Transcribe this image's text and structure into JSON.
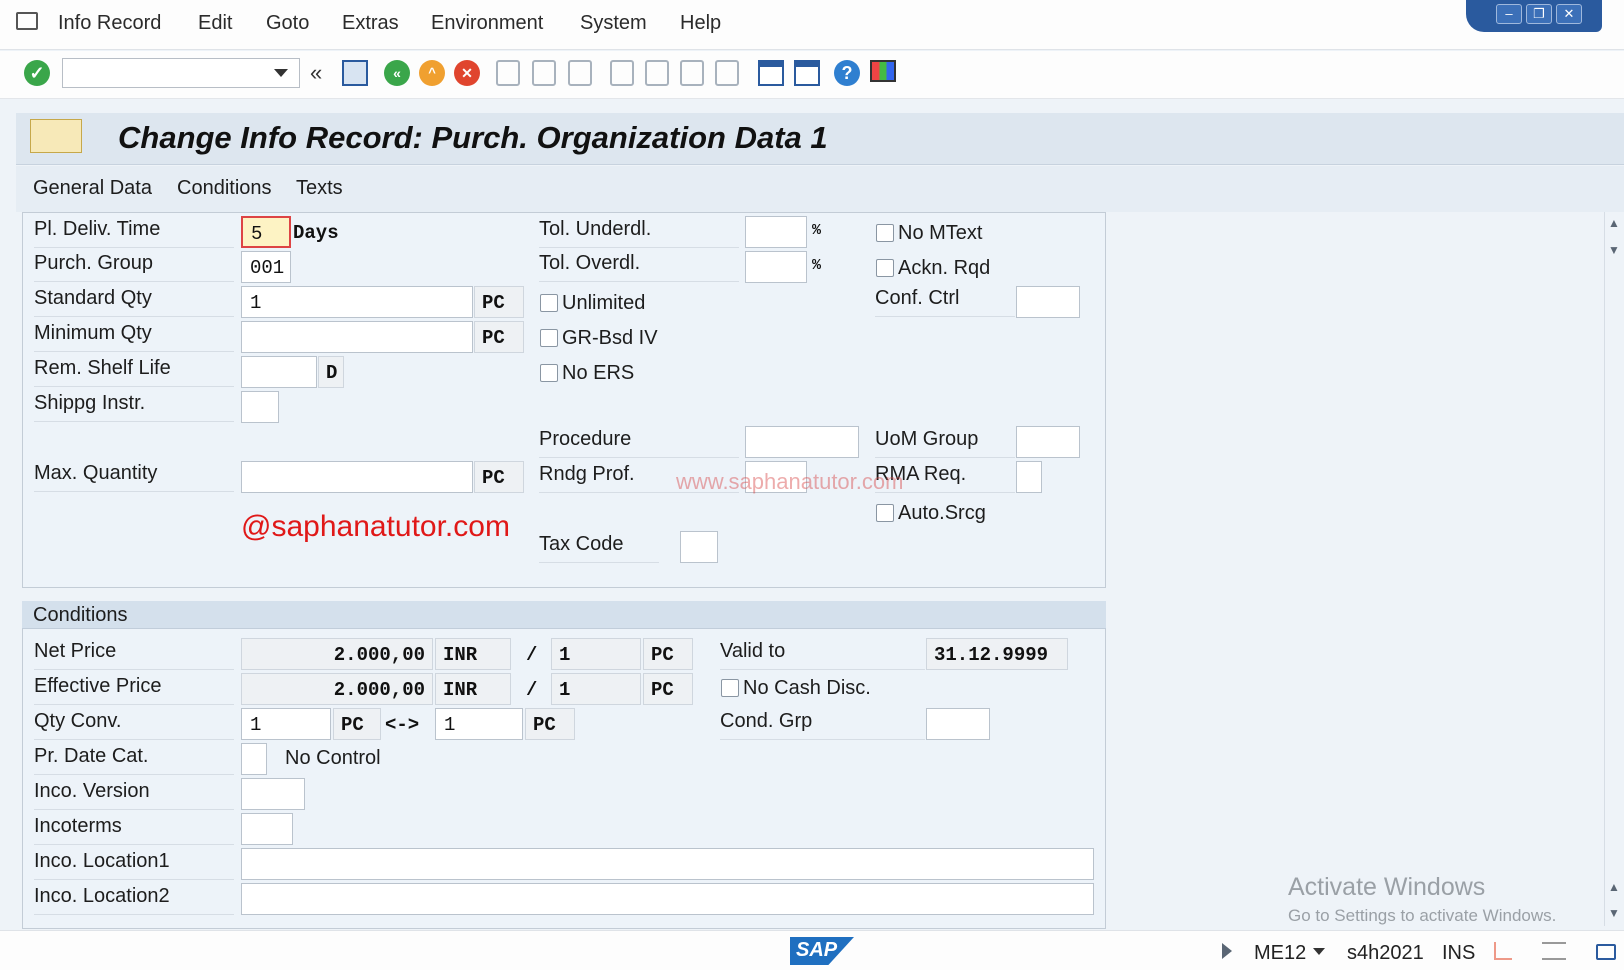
{
  "menu": [
    "Info Record",
    "Edit",
    "Goto",
    "Extras",
    "Environment",
    "System",
    "Help"
  ],
  "title": "Change Info Record: Purch. Organization Data 1",
  "tabs": [
    "General Data",
    "Conditions",
    "Texts"
  ],
  "general": {
    "pl_deliv_time_label": "Pl. Deliv. Time",
    "pl_deliv_time_value": "5",
    "days_label": "Days",
    "purch_group_label": "Purch. Group",
    "purch_group_value": "001",
    "standard_qty_label": "Standard Qty",
    "standard_qty_value": "1",
    "standard_qty_unit": "PC",
    "minimum_qty_label": "Minimum Qty",
    "minimum_qty_value": "",
    "minimum_qty_unit": "PC",
    "rem_shelf_life_label": "Rem. Shelf Life",
    "rem_shelf_life_value": "",
    "rem_shelf_life_unit": "D",
    "shippg_instr_label": "Shippg Instr.",
    "shippg_instr_value": "",
    "max_quantity_label": "Max. Quantity",
    "max_quantity_value": "",
    "max_quantity_unit": "PC",
    "tol_underdl_label": "Tol. Underdl.",
    "tol_underdl_value": "",
    "percent": "%",
    "tol_overdl_label": "Tol. Overdl.",
    "tol_overdl_value": "",
    "unlimited_label": "Unlimited",
    "gr_bsd_iv_label": "GR-Bsd IV",
    "no_ers_label": "No ERS",
    "procedure_label": "Procedure",
    "procedure_value": "",
    "rndg_prof_label": "Rndg Prof.",
    "rndg_prof_value": "",
    "tax_code_label": "Tax Code",
    "tax_code_value": "",
    "no_mtext_label": "No MText",
    "ackn_rqd_label": "Ackn. Rqd",
    "conf_ctrl_label": "Conf. Ctrl",
    "conf_ctrl_value": "",
    "uom_group_label": "UoM Group",
    "uom_group_value": "",
    "rma_req_label": "RMA Req.",
    "rma_req_value": "",
    "auto_srcg_label": "Auto.Srcg"
  },
  "watermarks": {
    "url": "www.saphanatutor.com",
    "at": "@saphanatutor.com"
  },
  "conditions": {
    "section_title": "Conditions",
    "net_price_label": "Net Price",
    "net_price_value": "2.000,00",
    "net_price_currency": "INR",
    "slash": "/",
    "net_price_per": "1",
    "net_price_unit": "PC",
    "effective_price_label": "Effective Price",
    "effective_price_value": "2.000,00",
    "effective_price_currency": "INR",
    "effective_price_per": "1",
    "effective_price_unit": "PC",
    "qty_conv_label": "Qty Conv.",
    "qty_conv_from": "1",
    "qty_conv_from_unit": "PC",
    "qty_conv_arrow": "<->",
    "qty_conv_to": "1",
    "qty_conv_to_unit": "PC",
    "pr_date_cat_label": "Pr. Date Cat.",
    "pr_date_cat_value": "",
    "pr_date_cat_text": "No Control",
    "inco_version_label": "Inco. Version",
    "inco_version_value": "",
    "incoterms_label": "Incoterms",
    "incoterms_value": "",
    "inco_location1_label": "Inco. Location1",
    "inco_location1_value": "",
    "inco_location2_label": "Inco. Location2",
    "inco_location2_value": "",
    "valid_to_label": "Valid to",
    "valid_to_value": "31.12.9999",
    "no_cash_disc_label": "No Cash Disc.",
    "cond_grp_label": "Cond. Grp",
    "cond_grp_value": ""
  },
  "status": {
    "sap_logo": "SAP",
    "transaction": "ME12",
    "system": "s4h2021",
    "mode": "INS"
  },
  "activate": {
    "line1": "Activate Windows",
    "line2": "Go to Settings to activate Windows."
  },
  "colors": {
    "accept": "#3aa64a",
    "back": "#3aa64a",
    "exit": "#f0a030",
    "cancel": "#e0452e",
    "brand": "#1f6fc0"
  }
}
